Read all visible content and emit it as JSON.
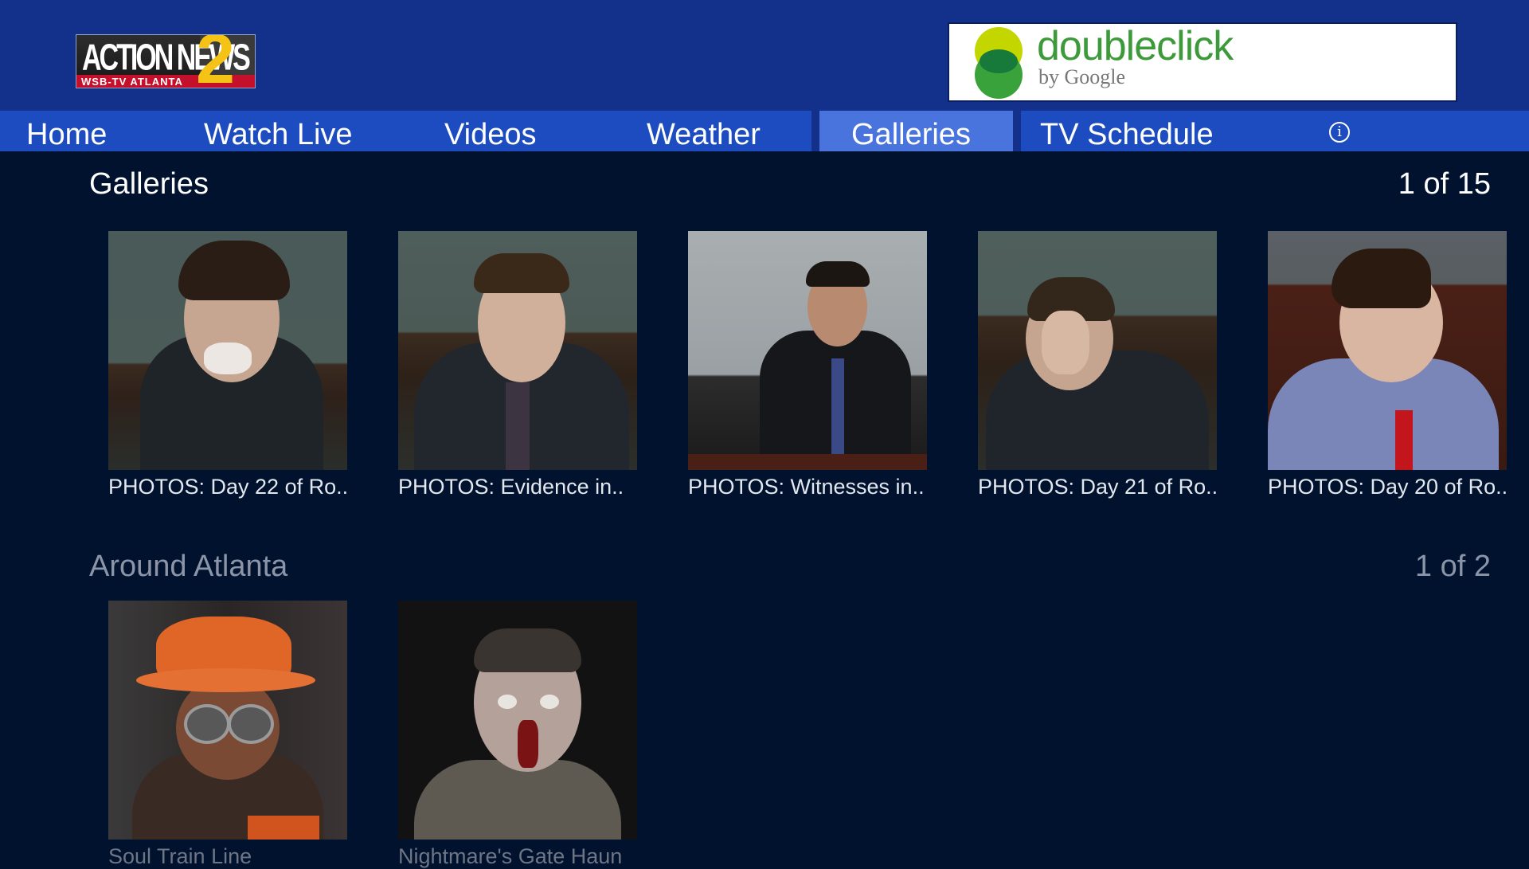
{
  "header": {
    "logo": {
      "main": "ACTION NEWS",
      "number": "2",
      "sub": "WSB-TV ATLANTA"
    },
    "ad": {
      "brand": "doubleclick",
      "byline": "by Google",
      "colors": {
        "lime": "#c3d600",
        "green": "#3aa23a",
        "text": "#3d9a3a"
      }
    }
  },
  "nav": {
    "items": [
      {
        "label": "Home"
      },
      {
        "label": "Watch Live"
      },
      {
        "label": "Videos"
      },
      {
        "label": "Weather"
      },
      {
        "label": "Galleries",
        "selected": true
      },
      {
        "label": "TV Schedule"
      }
    ],
    "info_icon": "info-icon",
    "info_glyph": "i"
  },
  "sections": [
    {
      "title": "Galleries",
      "count": "1 of 15",
      "items": [
        {
          "caption": "PHOTOS: Day 22 of Ro.."
        },
        {
          "caption": "PHOTOS: Evidence in.."
        },
        {
          "caption": "PHOTOS: Witnesses in.."
        },
        {
          "caption": "PHOTOS: Day 21 of Ro.."
        },
        {
          "caption": "PHOTOS: Day 20 of Ro.."
        }
      ]
    },
    {
      "title": "Around Atlanta",
      "count": "1 of 2",
      "items": [
        {
          "caption": "Soul Train Line"
        },
        {
          "caption": "Nightmare's Gate Haun"
        }
      ]
    }
  ],
  "colors": {
    "header_bg": "#13318a",
    "nav_bg": "#1c4cc0",
    "nav_selected": "#4a74dd",
    "page_bg": "#00122e"
  }
}
